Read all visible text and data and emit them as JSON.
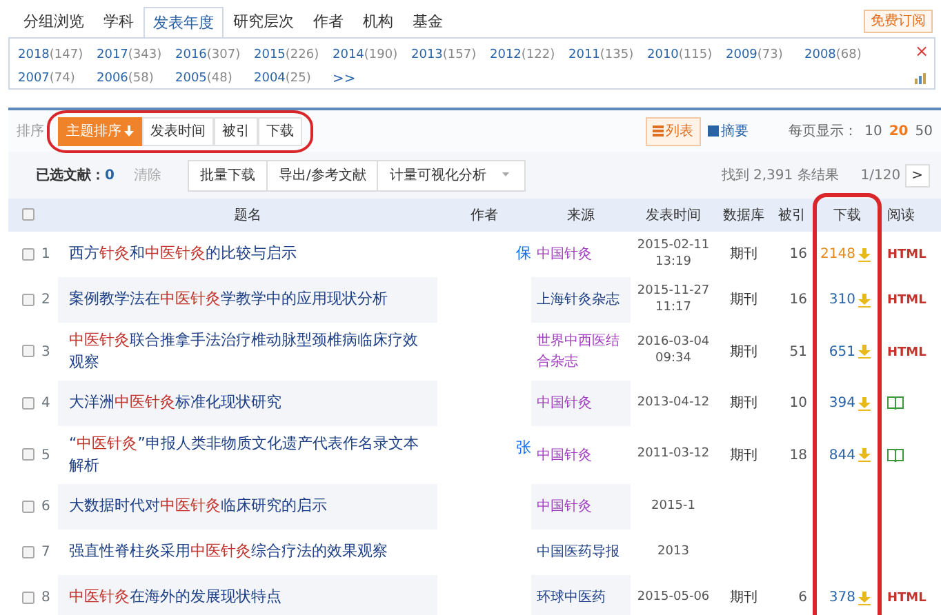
{
  "filter_tabs": [
    {
      "label": "分组浏览",
      "selected": false
    },
    {
      "label": "学科",
      "selected": false
    },
    {
      "label": "发表年度",
      "selected": true
    },
    {
      "label": "研究层次",
      "selected": false
    },
    {
      "label": "作者",
      "selected": false
    },
    {
      "label": "机构",
      "selected": false
    },
    {
      "label": "基金",
      "selected": false
    }
  ],
  "subscribe_button": "免费订阅",
  "years": [
    {
      "year": "2018",
      "count": "(147)"
    },
    {
      "year": "2017",
      "count": "(343)"
    },
    {
      "year": "2016",
      "count": "(307)"
    },
    {
      "year": "2015",
      "count": "(226)"
    },
    {
      "year": "2014",
      "count": "(190)"
    },
    {
      "year": "2013",
      "count": "(157)"
    },
    {
      "year": "2012",
      "count": "(122)"
    },
    {
      "year": "2011",
      "count": "(135)"
    },
    {
      "year": "2010",
      "count": "(115)"
    },
    {
      "year": "2009",
      "count": "(73)"
    },
    {
      "year": "2008",
      "count": "(68)"
    },
    {
      "year": "2007",
      "count": "(74)"
    },
    {
      "year": "2006",
      "count": "(58)"
    },
    {
      "year": "2005",
      "count": "(48)"
    },
    {
      "year": "2004",
      "count": "(25)"
    }
  ],
  "years_more": ">>",
  "close": "×",
  "sort": {
    "label": "排序",
    "annotated": true,
    "options": [
      {
        "label": "主题排序",
        "selected": true
      },
      {
        "label": "发表时间",
        "selected": false
      },
      {
        "label": "被引",
        "selected": false
      },
      {
        "label": "下载",
        "selected": false
      }
    ]
  },
  "view_modes": [
    {
      "label": "列表",
      "selected": true
    },
    {
      "label": "摘要",
      "selected": false
    }
  ],
  "page_size": {
    "label": "每页显示：",
    "options": [
      {
        "label": "10",
        "selected": false
      },
      {
        "label": "20",
        "selected": true
      },
      {
        "label": "50",
        "selected": false
      }
    ]
  },
  "selection": {
    "label": "已选文献：",
    "count": "0",
    "clear": "清除"
  },
  "actions": [
    "批量下载",
    "导出/参考文献",
    "计量可视化分析"
  ],
  "results": "找到 2,391 条结果",
  "pager": "1/120",
  "next": ">",
  "table": {
    "columns": [
      "题名",
      "作者",
      "来源",
      "发表时间",
      "数据库",
      "被引",
      "下载",
      "阅读"
    ],
    "all_checked": false,
    "download_annotated": true,
    "rows": [
      {
        "checked": false,
        "number": "1",
        "title": "西方**针灸**和**中医针灸**的比较与启示",
        "author": "保",
        "source": "中国针灸",
        "source_visited": true,
        "date": "2015-02-11",
        "time": "13:19",
        "database": "期刊",
        "cited": "16",
        "downloads": "2148",
        "downloads_hot": true,
        "read": {
          "kind": "html",
          "label": "HTML"
        }
      },
      {
        "checked": false,
        "number": "2",
        "title": "案例教学法在**中医针灸**学教学中的应用现状分析",
        "source": "上海针灸杂志",
        "source_visited": false,
        "date": "2015-11-27",
        "time": "11:17",
        "database": "期刊",
        "cited": "16",
        "downloads": "310",
        "downloads_hot": false,
        "read": {
          "kind": "html",
          "label": "HTML"
        }
      },
      {
        "checked": false,
        "number": "3",
        "title": "**中医针灸**联合推拿手法治疗椎动脉型颈椎病临床疗效观察",
        "source": "世界中西医结合杂志",
        "source_visited": true,
        "date": "2016-03-04",
        "time": "09:34",
        "database": "期刊",
        "cited": "51",
        "downloads": "651",
        "downloads_hot": false,
        "read": {
          "kind": "html",
          "label": "HTML"
        }
      },
      {
        "checked": false,
        "number": "4",
        "title": "大洋洲**中医针灸**标准化现状研究",
        "source": "中国针灸",
        "source_visited": true,
        "date": "2013-04-12",
        "database": "期刊",
        "cited": "10",
        "downloads": "394",
        "downloads_hot": false,
        "read": {
          "kind": "book"
        }
      },
      {
        "checked": false,
        "number": "5",
        "title": "“**中医针灸**”申报人类非物质文化遗产代表作名录文本解析",
        "author": "张",
        "source": "中国针灸",
        "source_visited": true,
        "date": "2011-03-12",
        "database": "期刊",
        "cited": "18",
        "downloads": "844",
        "downloads_hot": false,
        "read": {
          "kind": "book"
        }
      },
      {
        "checked": false,
        "number": "6",
        "title": "大数据时代对**中医针灸**临床研究的启示",
        "source": "中国针灸",
        "source_visited": true,
        "date": "2015-1"
      },
      {
        "checked": false,
        "number": "7",
        "title": "强直性脊柱炎采用**中医针灸**综合疗法的效果观察",
        "source": "中国医药导报",
        "source_visited": false,
        "date": "2013"
      },
      {
        "checked": false,
        "number": "8",
        "title": "**中医针灸**在海外的发展现状特点",
        "source": "环球中医药",
        "source_visited": false,
        "date": "2015-05-06",
        "database": "期刊",
        "cited": "6",
        "downloads": "378",
        "downloads_hot": false,
        "read": {
          "kind": "html",
          "label": "HTML"
        }
      }
    ]
  }
}
